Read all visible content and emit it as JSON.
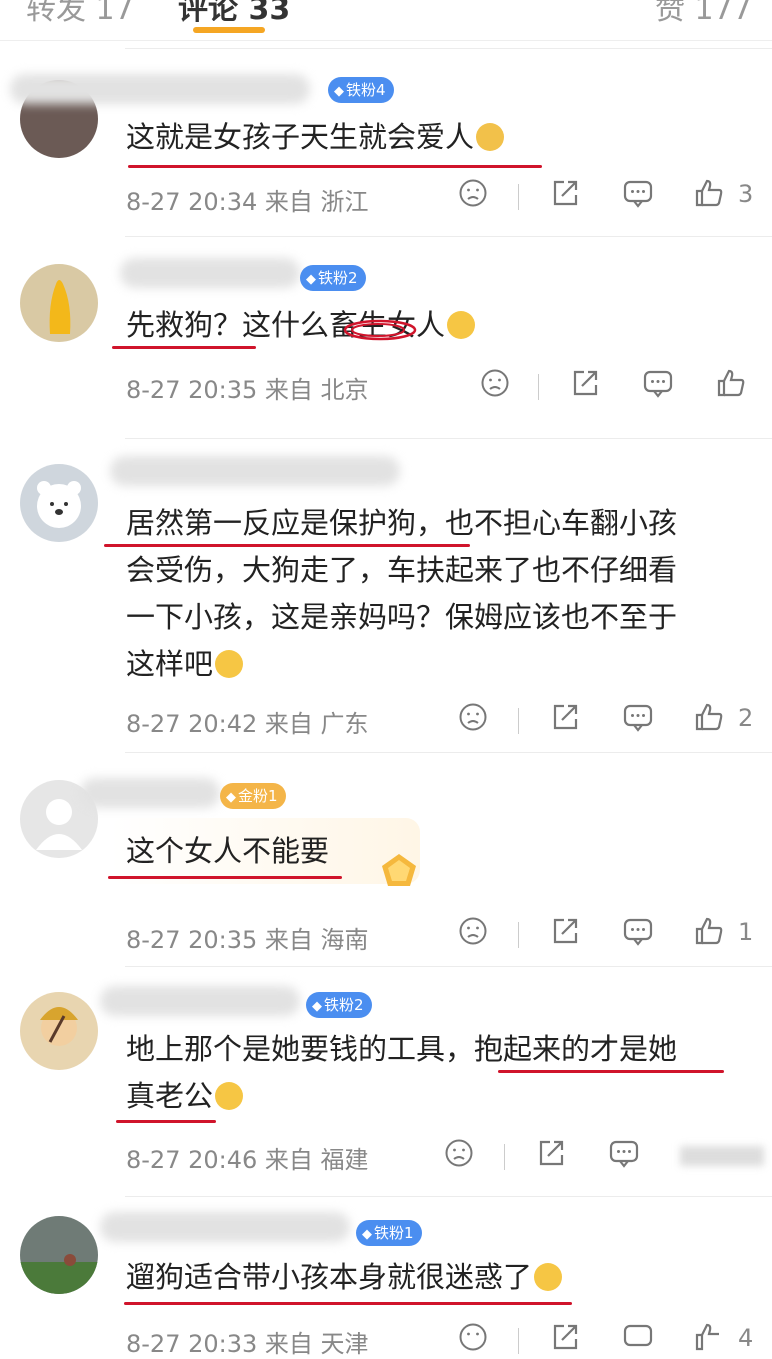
{
  "tabs": {
    "left_partial": "转发 17",
    "comments": "评论 33",
    "right_partial": "赞 177"
  },
  "comments": [
    {
      "badge": "铁粉4",
      "text": "这就是女孩子天生就会爱人",
      "time": "8-27 20:34",
      "location": "来自 浙江",
      "likes": "3"
    },
    {
      "badge": "铁粉2",
      "text": "先救狗？这什么畜生女人",
      "time": "8-27 20:35",
      "location": "来自 北京",
      "likes": ""
    },
    {
      "badge": "",
      "text_lines": [
        "居然第一反应是保护狗，也不担心车翻小孩",
        "会受伤，大狗走了，车扶起来了也不仔细看",
        "一下小孩，这是亲妈吗？保姆应该也不至于",
        "这样吧"
      ],
      "time": "8-27 20:42",
      "location": "来自 广东",
      "likes": "2"
    },
    {
      "badge": "金粉1",
      "text": "这个女人不能要",
      "time": "8-27 20:35",
      "location": "来自 海南",
      "likes": "1"
    },
    {
      "badge": "铁粉2",
      "text_lines": [
        "地上那个是她要钱的工具，抱起来的才是她",
        "真老公"
      ],
      "time": "8-27 20:46",
      "location": "来自 福建",
      "likes": ""
    },
    {
      "badge": "铁粉1",
      "text": "遛狗适合带小孩本身就很迷惑了",
      "time": "8-27 20:33",
      "location": "来自 天津",
      "likes": "4"
    }
  ],
  "colors": {
    "accent": "#f5a623",
    "badge_blue": "#4b8ef0",
    "badge_gold": "#f4b548",
    "annotation_red": "#d0142b"
  },
  "icons": [
    "dislike-face-icon",
    "share-icon",
    "comment-icon",
    "like-thumb-icon"
  ]
}
